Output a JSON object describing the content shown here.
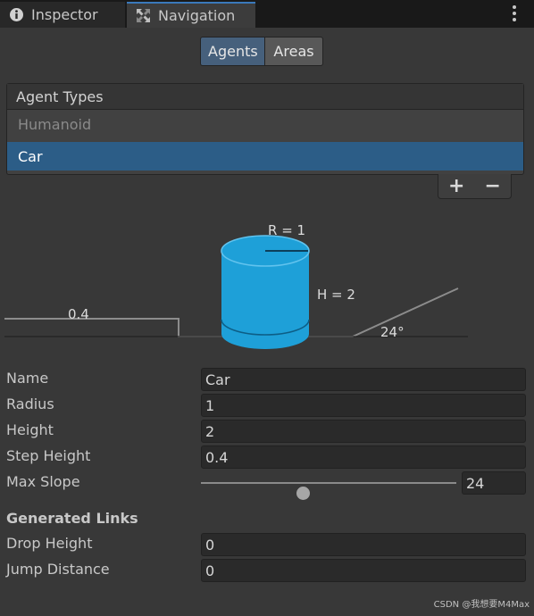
{
  "tabs": {
    "inspector": "Inspector",
    "navigation": "Navigation"
  },
  "mode_toggle": {
    "agents": "Agents",
    "areas": "Areas"
  },
  "agent_types": {
    "header": "Agent Types",
    "items": [
      "Humanoid",
      "Car"
    ],
    "selected": "Car",
    "add_label": "+",
    "remove_label": "−"
  },
  "diagram": {
    "radius_label": "R = 1",
    "height_label": "H = 2",
    "step_label": "0.4",
    "slope_label": "24°"
  },
  "fields": {
    "name": {
      "label": "Name",
      "value": "Car"
    },
    "radius": {
      "label": "Radius",
      "value": "1"
    },
    "height": {
      "label": "Height",
      "value": "2"
    },
    "step_height": {
      "label": "Step Height",
      "value": "0.4"
    },
    "max_slope": {
      "label": "Max Slope",
      "value": "24",
      "slider_fraction": 0.4
    }
  },
  "generated_links": {
    "title": "Generated Links",
    "drop_height": {
      "label": "Drop Height",
      "value": "0"
    },
    "jump_distance": {
      "label": "Jump Distance",
      "value": "0"
    }
  },
  "watermark": "CSDN @我想要M4Max",
  "colors": {
    "selection": "#2c5d87",
    "cylinder": "#1ea0d8",
    "active_toggle": "#46607c"
  }
}
